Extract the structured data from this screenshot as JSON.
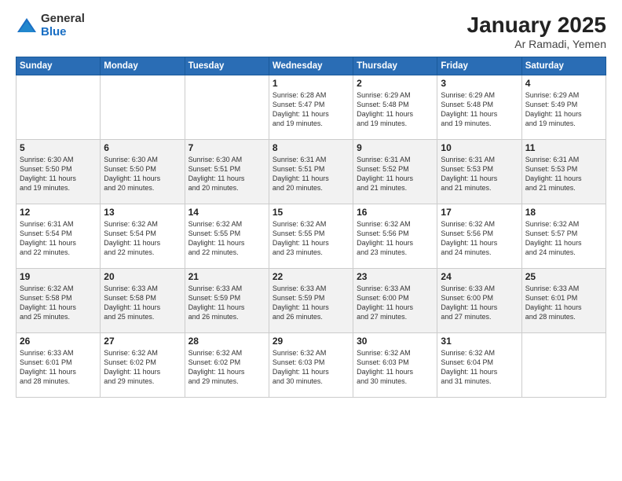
{
  "logo": {
    "general": "General",
    "blue": "Blue"
  },
  "title": "January 2025",
  "subtitle": "Ar Ramadi, Yemen",
  "weekdays": [
    "Sunday",
    "Monday",
    "Tuesday",
    "Wednesday",
    "Thursday",
    "Friday",
    "Saturday"
  ],
  "weeks": [
    [
      {
        "day": "",
        "info": ""
      },
      {
        "day": "",
        "info": ""
      },
      {
        "day": "",
        "info": ""
      },
      {
        "day": "1",
        "info": "Sunrise: 6:28 AM\nSunset: 5:47 PM\nDaylight: 11 hours\nand 19 minutes."
      },
      {
        "day": "2",
        "info": "Sunrise: 6:29 AM\nSunset: 5:48 PM\nDaylight: 11 hours\nand 19 minutes."
      },
      {
        "day": "3",
        "info": "Sunrise: 6:29 AM\nSunset: 5:48 PM\nDaylight: 11 hours\nand 19 minutes."
      },
      {
        "day": "4",
        "info": "Sunrise: 6:29 AM\nSunset: 5:49 PM\nDaylight: 11 hours\nand 19 minutes."
      }
    ],
    [
      {
        "day": "5",
        "info": "Sunrise: 6:30 AM\nSunset: 5:50 PM\nDaylight: 11 hours\nand 19 minutes."
      },
      {
        "day": "6",
        "info": "Sunrise: 6:30 AM\nSunset: 5:50 PM\nDaylight: 11 hours\nand 20 minutes."
      },
      {
        "day": "7",
        "info": "Sunrise: 6:30 AM\nSunset: 5:51 PM\nDaylight: 11 hours\nand 20 minutes."
      },
      {
        "day": "8",
        "info": "Sunrise: 6:31 AM\nSunset: 5:51 PM\nDaylight: 11 hours\nand 20 minutes."
      },
      {
        "day": "9",
        "info": "Sunrise: 6:31 AM\nSunset: 5:52 PM\nDaylight: 11 hours\nand 21 minutes."
      },
      {
        "day": "10",
        "info": "Sunrise: 6:31 AM\nSunset: 5:53 PM\nDaylight: 11 hours\nand 21 minutes."
      },
      {
        "day": "11",
        "info": "Sunrise: 6:31 AM\nSunset: 5:53 PM\nDaylight: 11 hours\nand 21 minutes."
      }
    ],
    [
      {
        "day": "12",
        "info": "Sunrise: 6:31 AM\nSunset: 5:54 PM\nDaylight: 11 hours\nand 22 minutes."
      },
      {
        "day": "13",
        "info": "Sunrise: 6:32 AM\nSunset: 5:54 PM\nDaylight: 11 hours\nand 22 minutes."
      },
      {
        "day": "14",
        "info": "Sunrise: 6:32 AM\nSunset: 5:55 PM\nDaylight: 11 hours\nand 22 minutes."
      },
      {
        "day": "15",
        "info": "Sunrise: 6:32 AM\nSunset: 5:55 PM\nDaylight: 11 hours\nand 23 minutes."
      },
      {
        "day": "16",
        "info": "Sunrise: 6:32 AM\nSunset: 5:56 PM\nDaylight: 11 hours\nand 23 minutes."
      },
      {
        "day": "17",
        "info": "Sunrise: 6:32 AM\nSunset: 5:56 PM\nDaylight: 11 hours\nand 24 minutes."
      },
      {
        "day": "18",
        "info": "Sunrise: 6:32 AM\nSunset: 5:57 PM\nDaylight: 11 hours\nand 24 minutes."
      }
    ],
    [
      {
        "day": "19",
        "info": "Sunrise: 6:32 AM\nSunset: 5:58 PM\nDaylight: 11 hours\nand 25 minutes."
      },
      {
        "day": "20",
        "info": "Sunrise: 6:33 AM\nSunset: 5:58 PM\nDaylight: 11 hours\nand 25 minutes."
      },
      {
        "day": "21",
        "info": "Sunrise: 6:33 AM\nSunset: 5:59 PM\nDaylight: 11 hours\nand 26 minutes."
      },
      {
        "day": "22",
        "info": "Sunrise: 6:33 AM\nSunset: 5:59 PM\nDaylight: 11 hours\nand 26 minutes."
      },
      {
        "day": "23",
        "info": "Sunrise: 6:33 AM\nSunset: 6:00 PM\nDaylight: 11 hours\nand 27 minutes."
      },
      {
        "day": "24",
        "info": "Sunrise: 6:33 AM\nSunset: 6:00 PM\nDaylight: 11 hours\nand 27 minutes."
      },
      {
        "day": "25",
        "info": "Sunrise: 6:33 AM\nSunset: 6:01 PM\nDaylight: 11 hours\nand 28 minutes."
      }
    ],
    [
      {
        "day": "26",
        "info": "Sunrise: 6:33 AM\nSunset: 6:01 PM\nDaylight: 11 hours\nand 28 minutes."
      },
      {
        "day": "27",
        "info": "Sunrise: 6:32 AM\nSunset: 6:02 PM\nDaylight: 11 hours\nand 29 minutes."
      },
      {
        "day": "28",
        "info": "Sunrise: 6:32 AM\nSunset: 6:02 PM\nDaylight: 11 hours\nand 29 minutes."
      },
      {
        "day": "29",
        "info": "Sunrise: 6:32 AM\nSunset: 6:03 PM\nDaylight: 11 hours\nand 30 minutes."
      },
      {
        "day": "30",
        "info": "Sunrise: 6:32 AM\nSunset: 6:03 PM\nDaylight: 11 hours\nand 30 minutes."
      },
      {
        "day": "31",
        "info": "Sunrise: 6:32 AM\nSunset: 6:04 PM\nDaylight: 11 hours\nand 31 minutes."
      },
      {
        "day": "",
        "info": ""
      }
    ]
  ]
}
